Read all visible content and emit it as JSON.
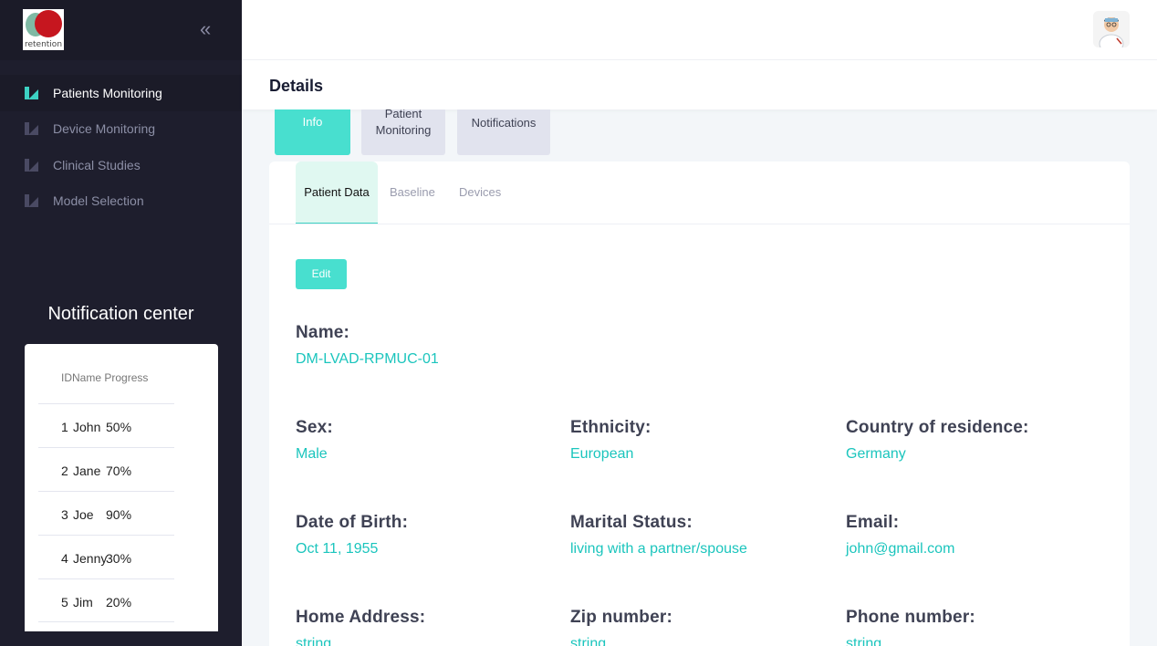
{
  "app": {
    "logo_text": "retention",
    "avatar_alt": "doctor-avatar"
  },
  "sidebar": {
    "items": [
      {
        "label": "Patients Monitoring",
        "active": true
      },
      {
        "label": "Device Monitoring",
        "active": false
      },
      {
        "label": "Clinical Studies",
        "active": false
      },
      {
        "label": "Model Selection",
        "active": false
      }
    ],
    "notification_center": {
      "title": "Notification center",
      "headers": {
        "id": "ID",
        "name": "Name",
        "progress": "Progress"
      },
      "rows": [
        {
          "id": "1",
          "name": "John",
          "progress": "50%"
        },
        {
          "id": "2",
          "name": "Jane",
          "progress": "70%"
        },
        {
          "id": "3",
          "name": "Joe",
          "progress": "90%"
        },
        {
          "id": "4",
          "name": "Jenny",
          "progress": "30%"
        },
        {
          "id": "5",
          "name": "Jim",
          "progress": "20%"
        }
      ]
    }
  },
  "header": {
    "title": "Details"
  },
  "upper_tabs": [
    {
      "label": "Basic Patient Info",
      "active": true
    },
    {
      "label": "Patient Monitoring",
      "active": false
    },
    {
      "label": "Notifications",
      "active": false
    }
  ],
  "inner_tabs": [
    {
      "label": "Patient Data",
      "active": true
    },
    {
      "label": "Baseline",
      "active": false
    },
    {
      "label": "Devices",
      "active": false
    }
  ],
  "edit_label": "Edit",
  "fields": {
    "name": {
      "label": "Name:",
      "value": "DM-LVAD-RPMUC-01"
    },
    "sex": {
      "label": "Sex:",
      "value": "Male"
    },
    "ethnicity": {
      "label": "Ethnicity:",
      "value": "European"
    },
    "country": {
      "label": "Country of residence:",
      "value": "Germany"
    },
    "dob": {
      "label": "Date of Birth:",
      "value": "Oct 11, 1955"
    },
    "marital": {
      "label": "Marital Status:",
      "value": "living with a partner/spouse"
    },
    "email": {
      "label": "Email:",
      "value": "john@gmail.com"
    },
    "address": {
      "label": "Home Address:",
      "value": "string"
    },
    "zip": {
      "label": "Zip number:",
      "value": "string"
    },
    "phone": {
      "label": "Phone number:",
      "value": "string"
    }
  },
  "colors": {
    "accent": "#48dfcf",
    "value_text": "#1bc5bd",
    "sidebar_bg": "#1e1e2d"
  }
}
